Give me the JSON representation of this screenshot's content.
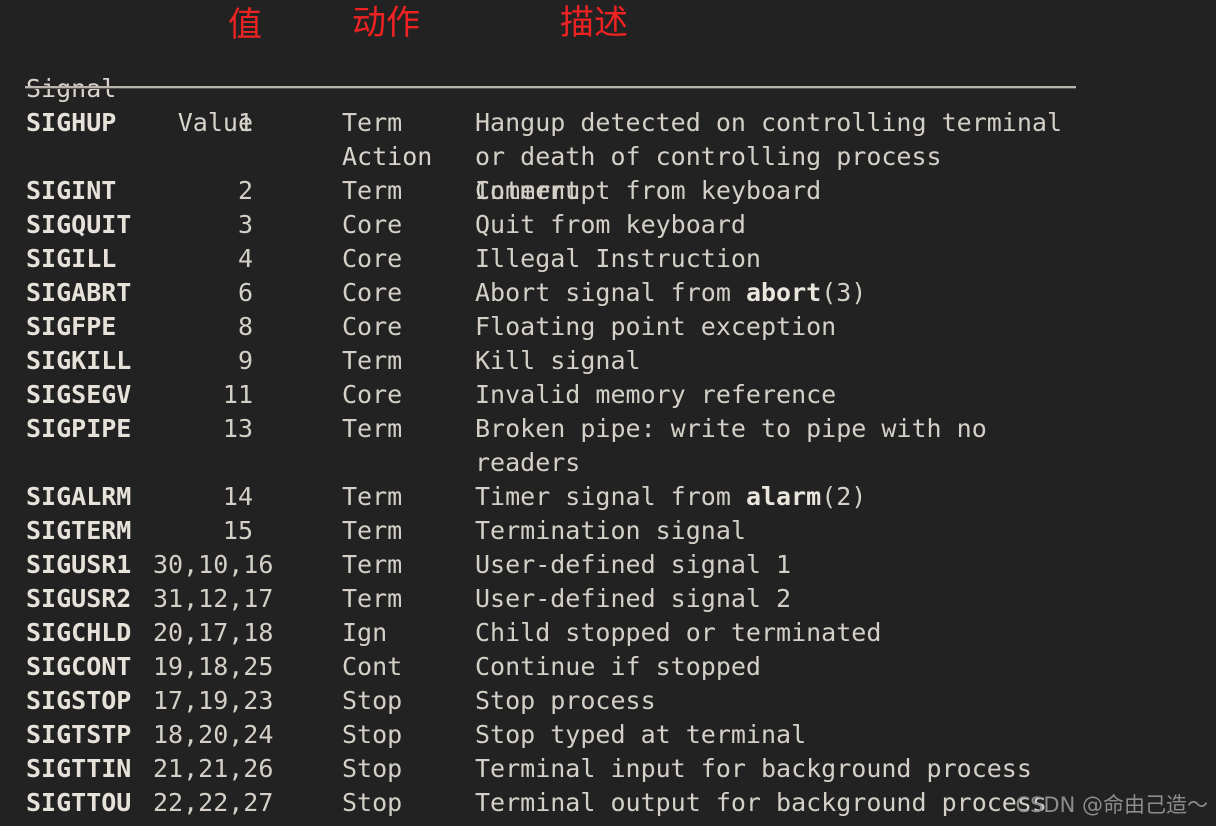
{
  "background_color": "#222222",
  "text_color": "#d4d0c8",
  "annotation_color": "#ee2222",
  "watermark_color": "#8d8d8d",
  "annotations": {
    "value": "值",
    "action": "动作",
    "comment": "描述"
  },
  "headers": {
    "signal": "Signal",
    "value": "Value",
    "action": "Action",
    "comment": "Comment"
  },
  "rows": [
    {
      "signal": "SIGHUP",
      "value": "1",
      "action": "Term",
      "comment": "Hangup detected on controlling terminal"
    },
    {
      "signal": "",
      "value": "",
      "action": "",
      "comment": "or death of controlling process"
    },
    {
      "signal": "SIGINT",
      "value": "2",
      "action": "Term",
      "comment": "Interrupt from keyboard"
    },
    {
      "signal": "SIGQUIT",
      "value": "3",
      "action": "Core",
      "comment": "Quit from keyboard"
    },
    {
      "signal": "SIGILL",
      "value": "4",
      "action": "Core",
      "comment": "Illegal Instruction"
    },
    {
      "signal": "SIGABRT",
      "value": "6",
      "action": "Core",
      "comment": "Abort signal from ",
      "comment_bold": "abort",
      "comment_tail": "(3)"
    },
    {
      "signal": "SIGFPE",
      "value": "8",
      "action": "Core",
      "comment": "Floating point exception"
    },
    {
      "signal": "SIGKILL",
      "value": "9",
      "action": "Term",
      "comment": "Kill signal"
    },
    {
      "signal": "SIGSEGV",
      "value": "11",
      "action": "Core",
      "comment": "Invalid memory reference"
    },
    {
      "signal": "SIGPIPE",
      "value": "13",
      "action": "Term",
      "comment": "Broken pipe: write to pipe with no"
    },
    {
      "signal": "",
      "value": "",
      "action": "",
      "comment": "readers"
    },
    {
      "signal": "SIGALRM",
      "value": "14",
      "action": "Term",
      "comment": "Timer signal from ",
      "comment_bold": "alarm",
      "comment_tail": "(2)"
    },
    {
      "signal": "SIGTERM",
      "value": "15",
      "action": "Term",
      "comment": "Termination signal"
    },
    {
      "signal": "SIGUSR1",
      "value": "30,10,16",
      "action": "Term",
      "comment": "User-defined signal 1"
    },
    {
      "signal": "SIGUSR2",
      "value": "31,12,17",
      "action": "Term",
      "comment": "User-defined signal 2"
    },
    {
      "signal": "SIGCHLD",
      "value": "20,17,18",
      "action": "Ign",
      "comment": "Child stopped or terminated"
    },
    {
      "signal": "SIGCONT",
      "value": "19,18,25",
      "action": "Cont",
      "comment": "Continue if stopped"
    },
    {
      "signal": "SIGSTOP",
      "value": "17,19,23",
      "action": "Stop",
      "comment": "Stop process"
    },
    {
      "signal": "SIGTSTP",
      "value": "18,20,24",
      "action": "Stop",
      "comment": "Stop typed at terminal"
    },
    {
      "signal": "SIGTTIN",
      "value": "21,21,26",
      "action": "Stop",
      "comment": "Terminal input for background process"
    },
    {
      "signal": "SIGTTOU",
      "value": "22,22,27",
      "action": "Stop",
      "comment": "Terminal output for background process"
    }
  ],
  "watermark": "CSDN @命由己造～"
}
